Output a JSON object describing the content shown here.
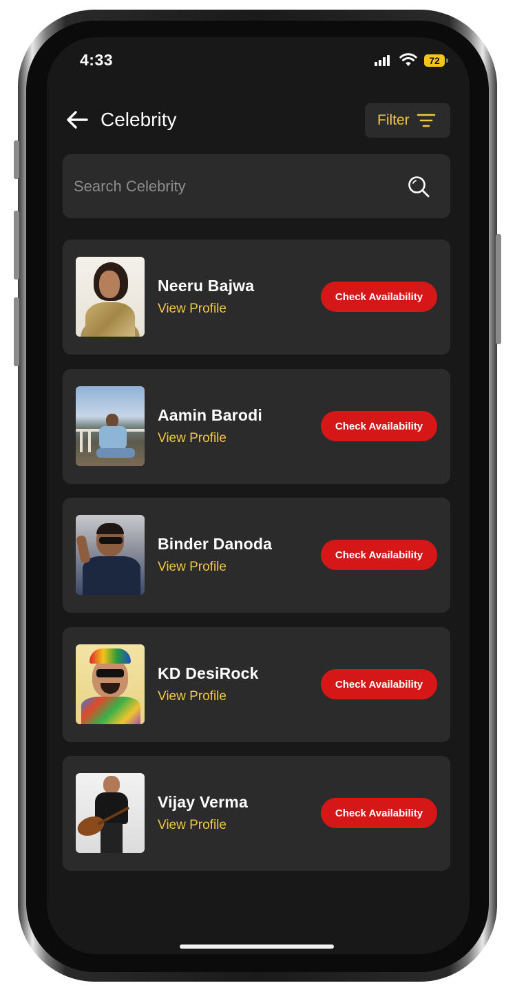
{
  "status_bar": {
    "time": "4:33",
    "battery": "72"
  },
  "header": {
    "title": "Celebrity",
    "filter_label": "Filter"
  },
  "search": {
    "placeholder": "Search Celebrity"
  },
  "celebrities": [
    {
      "name": "Neeru Bajwa",
      "view_label": "View Profile",
      "action_label": "Check Availability"
    },
    {
      "name": "Aamin Barodi",
      "view_label": "View Profile",
      "action_label": "Check Availability"
    },
    {
      "name": "Binder Danoda",
      "view_label": "View Profile",
      "action_label": "Check Availability"
    },
    {
      "name": "KD DesiRock",
      "view_label": "View Profile",
      "action_label": "Check Availability"
    },
    {
      "name": "Vijay Verma",
      "view_label": "View Profile",
      "action_label": "Check Availability"
    }
  ],
  "colors": {
    "accent": "#f2c744",
    "action": "#d51717",
    "card": "#2b2b2b",
    "background": "#181818"
  },
  "icons": {
    "back": "arrow-left-icon",
    "filter": "filter-lines-icon",
    "search": "search-icon"
  }
}
